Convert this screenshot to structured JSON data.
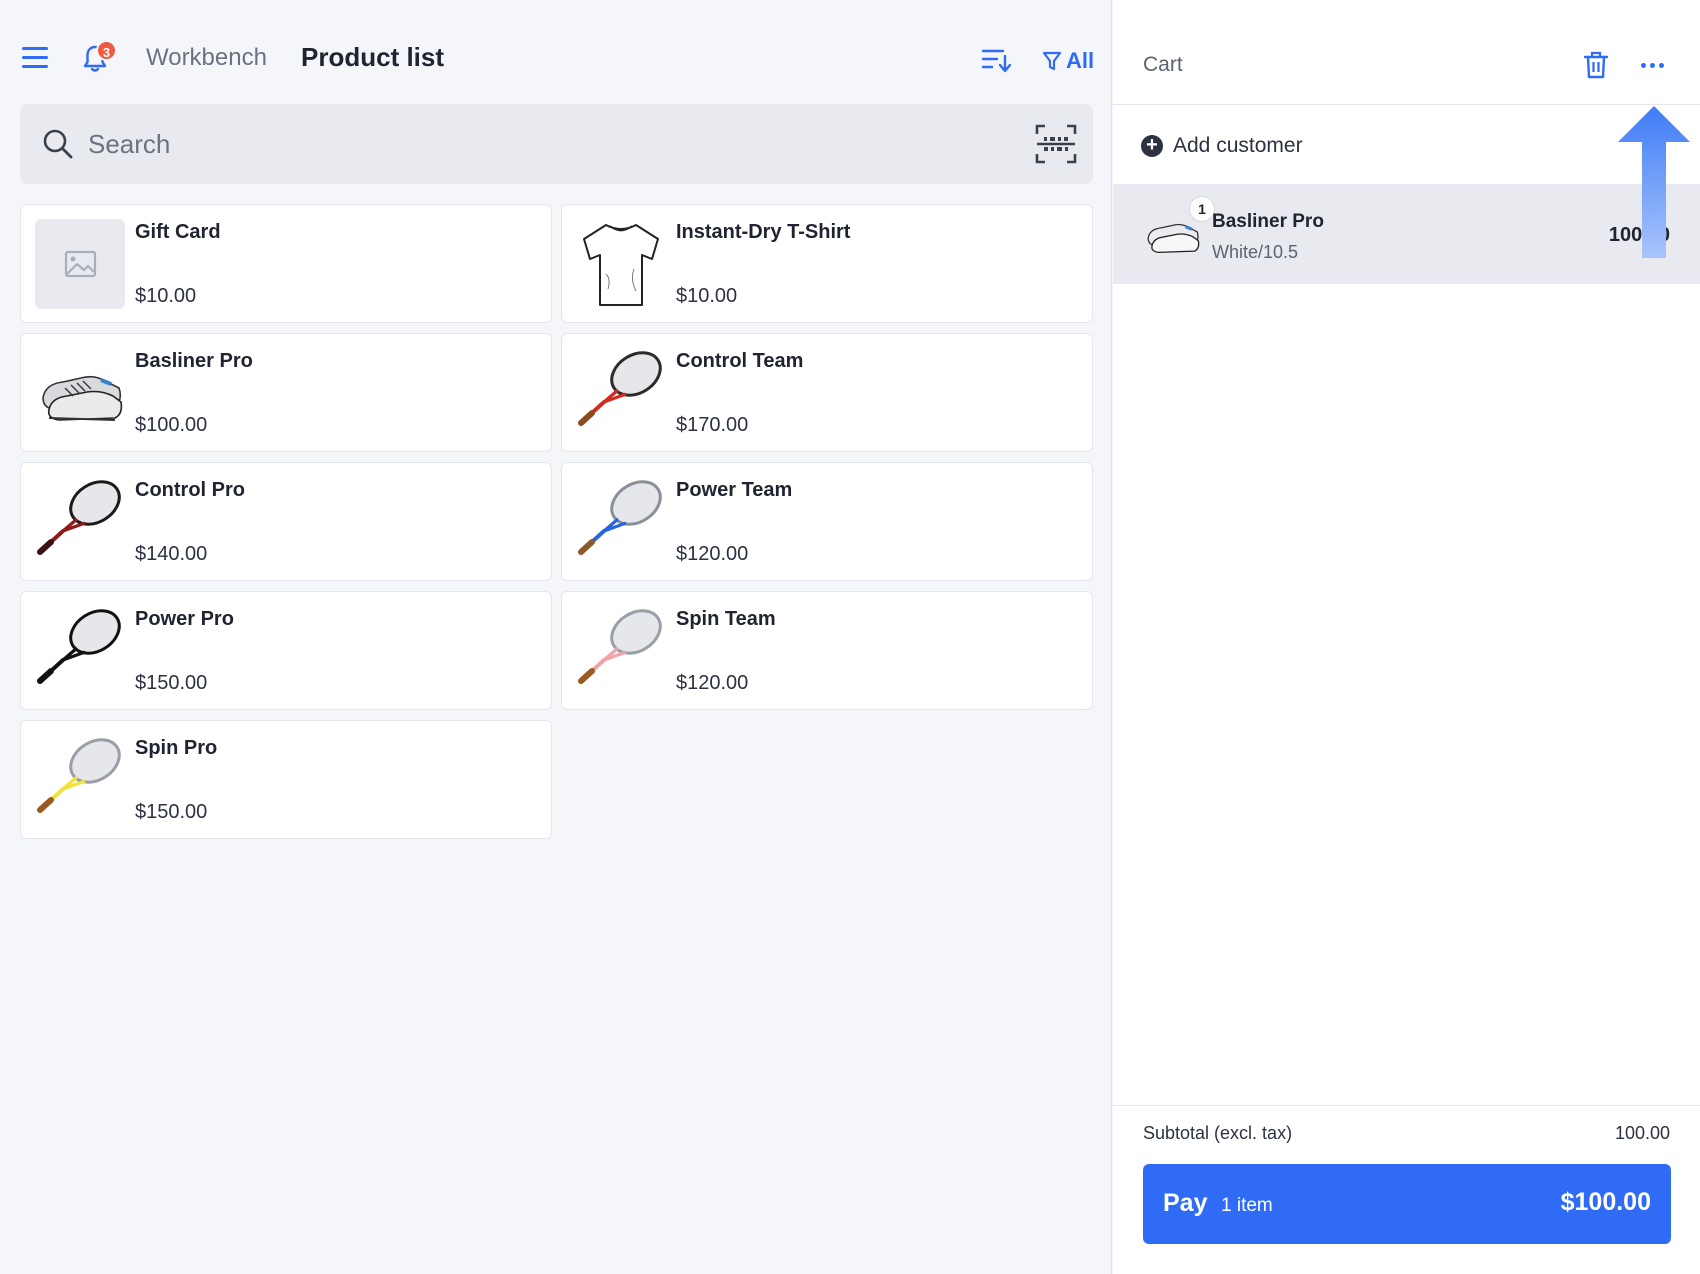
{
  "header": {
    "notification_count": "3",
    "breadcrumb": "Workbench",
    "title": "Product list",
    "filter_label": "All"
  },
  "search": {
    "placeholder": "Search"
  },
  "products": [
    {
      "name": "Gift Card",
      "price": "$10.00",
      "image": "image-placeholder-icon"
    },
    {
      "name": "Instant-Dry T-Shirt",
      "price": "$10.00",
      "image": "tshirt"
    },
    {
      "name": "Basliner Pro",
      "price": "$100.00",
      "image": "shoes"
    },
    {
      "name": "Control Team",
      "price": "$170.00",
      "image": "racket-red"
    },
    {
      "name": "Control Pro",
      "price": "$140.00",
      "image": "racket-darkred"
    },
    {
      "name": "Power Team",
      "price": "$120.00",
      "image": "racket-blue"
    },
    {
      "name": "Power Pro",
      "price": "$150.00",
      "image": "racket-black"
    },
    {
      "name": "Spin Team",
      "price": "$120.00",
      "image": "racket-pink"
    },
    {
      "name": "Spin Pro",
      "price": "$150.00",
      "image": "racket-yellow"
    }
  ],
  "cart": {
    "title": "Cart",
    "add_customer": "Add customer",
    "items": [
      {
        "quantity": "1",
        "name": "Basliner Pro",
        "variant": "White/10.5",
        "price": "100.00"
      }
    ],
    "subtotal_label": "Subtotal (excl. tax)",
    "subtotal_value": "100.00",
    "pay_label": "Pay",
    "pay_count": "1 item",
    "pay_amount": "$100.00"
  },
  "colors": {
    "accent": "#2f6bf5",
    "badge": "#f05a3e",
    "background": "#f5f6fa",
    "selected_row": "#e8eaef"
  }
}
